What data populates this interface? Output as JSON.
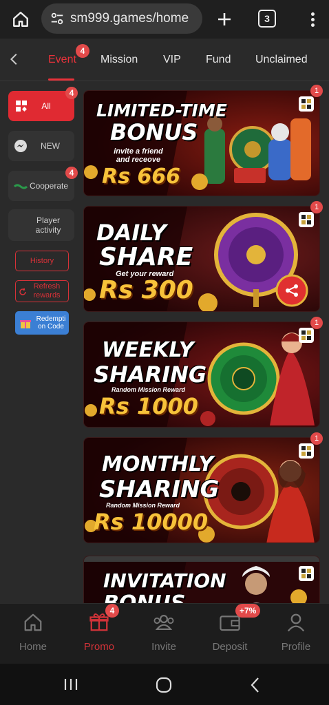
{
  "browser": {
    "url": "sm999.games/home",
    "tab_count": "3"
  },
  "topnav": {
    "tabs": [
      {
        "label": "Event",
        "badge": "4"
      },
      {
        "label": "Mission"
      },
      {
        "label": "VIP"
      },
      {
        "label": "Fund"
      },
      {
        "label": "Unclaimed"
      }
    ]
  },
  "sidebar": {
    "items": [
      {
        "label": "All",
        "badge": "4"
      },
      {
        "label": "NEW"
      },
      {
        "label": "Cooperate",
        "badge": "4"
      },
      {
        "label": "Player activity"
      }
    ],
    "history_label": "History",
    "refresh_label": "Refresh rewards",
    "redeem_label": "Redempti on Code"
  },
  "banners": [
    {
      "title_line1": "LIMITED-TIME",
      "title_line2": "BONUS",
      "subtitle": "invite a friend and receove",
      "amount": "Rs 666",
      "badge": "1"
    },
    {
      "title_line1": "DAILY",
      "title_line2": "SHARE",
      "subtitle": "Get your reward",
      "amount": "Rs 300",
      "badge": "1"
    },
    {
      "title_line1": "WEEKLY",
      "title_line2": "SHARING",
      "subtitle": "Random Mission Reward",
      "amount": "Rs 1000",
      "badge": "1"
    },
    {
      "title_line1": "MONTHLY",
      "title_line2": "SHARING",
      "subtitle": "Random Mission Reward",
      "amount": "Rs 10000",
      "badge": "1"
    },
    {
      "title_line1": "INVITATION",
      "title_line2": "BONUS"
    }
  ],
  "bottomnav": {
    "items": [
      {
        "label": "Home",
        "icon": "home-icon"
      },
      {
        "label": "Promo",
        "icon": "gift-icon",
        "badge": "4"
      },
      {
        "label": "Invite",
        "icon": "users-icon"
      },
      {
        "label": "Deposit",
        "icon": "wallet-icon",
        "badge": "+7%"
      },
      {
        "label": "Profile",
        "icon": "user-icon"
      }
    ]
  },
  "colors": {
    "accent": "#e8323a",
    "badge": "#e24a4a",
    "gold": "#f7c23a"
  }
}
